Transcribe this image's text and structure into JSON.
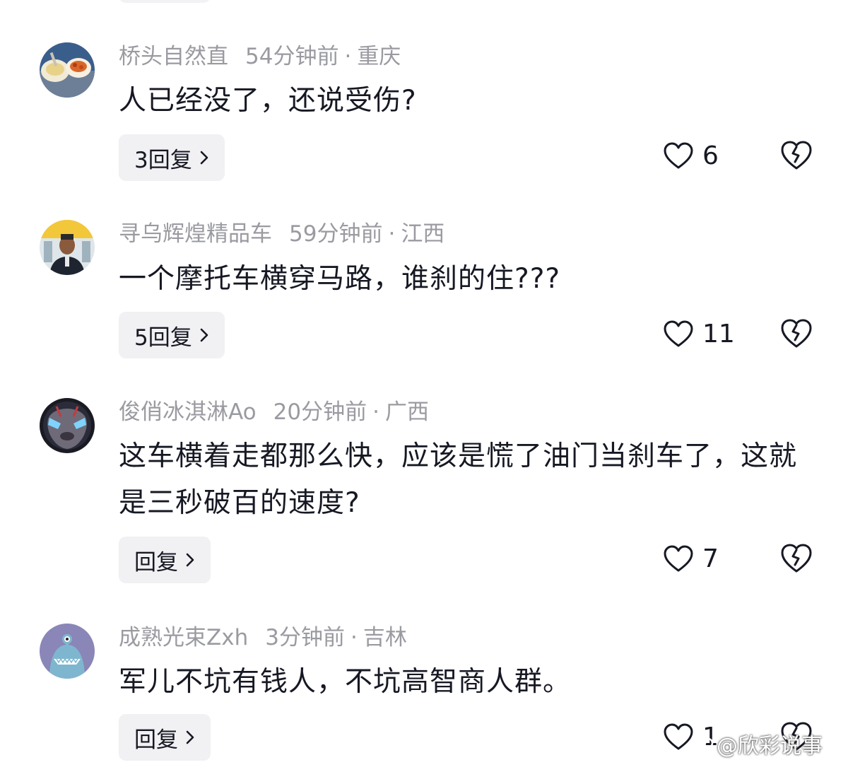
{
  "comments": [
    {
      "name": "桥头自然直",
      "time": "54分钟前",
      "location": "重庆",
      "separator": "·",
      "text": "人已经没了，还说受伤?",
      "reply_label": "3回复",
      "likes": "6",
      "avatar_icon": "avatar-food-photo"
    },
    {
      "name": "寻乌辉煌精品车",
      "time": "59分钟前",
      "location": "江西",
      "separator": "·",
      "text": "一个摩托车横穿马路，谁刹的住???",
      "reply_label": "5回复",
      "likes": "11",
      "avatar_icon": "avatar-man-photo"
    },
    {
      "name": "俊俏冰淇淋Ao",
      "time": "20分钟前",
      "location": "广西",
      "separator": "·",
      "text": "这车横着走都那么快，应该是慌了油门当刹车了，这就是三秒破百的速度?",
      "reply_label": "回复",
      "likes": "7",
      "avatar_icon": "avatar-alien-photo"
    },
    {
      "name": "成熟光束Zxh",
      "time": "3分钟前",
      "location": "吉林",
      "separator": "·",
      "text": "军儿不坑有钱人，不坑高智商人群。",
      "reply_label": "回复",
      "likes": "1",
      "avatar_icon": "avatar-monster-cartoon"
    }
  ],
  "watermark": "@欣彩说事",
  "colors": {
    "meta_gray": "#9a9ba1",
    "text_dark": "#161823",
    "reply_bg": "#f1f1f3"
  }
}
